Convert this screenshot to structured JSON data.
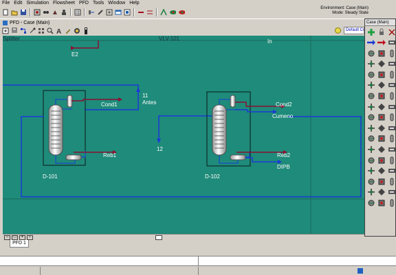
{
  "menu": [
    "File",
    "Edit",
    "Simulation",
    "Flowsheet",
    "PFD",
    "Tools",
    "Window",
    "Help"
  ],
  "environment": {
    "line1": "Environment: Case (Main)",
    "line2": "Mode: Steady State"
  },
  "window": {
    "title": "PFD - Case (Main)"
  },
  "toolbar2": {
    "combo": "Default Colo"
  },
  "canvas_labels": {
    "top_left": "Splitter",
    "top_center": "VLV-101",
    "top_right": "In",
    "e2": "E2",
    "s11": "11",
    "antes": "Antes",
    "cond1": "Cond1",
    "reb1": "Reb1",
    "d101": "D-101",
    "s12": "12",
    "cond2": "Cond2",
    "cumeno": "Cumeno",
    "reb2": "Reb2",
    "dipb": "DIPB",
    "d102": "D-102"
  },
  "tabs": [
    "PFD 1"
  ],
  "palette": {
    "title": "Case (Main)"
  },
  "colors": {
    "canvas": "#1f8b7a",
    "material_stream": "#1a3ad6",
    "energy_stream": "#8a1030"
  }
}
